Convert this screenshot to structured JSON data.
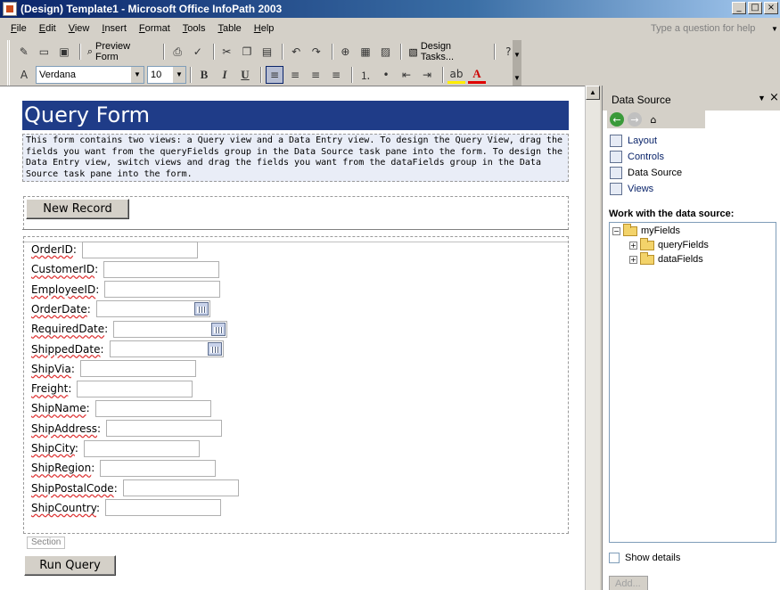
{
  "window": {
    "title": "(Design) Template1 - Microsoft Office InfoPath 2003",
    "controls": [
      "_",
      "□",
      "×"
    ]
  },
  "menubar": {
    "items": [
      "File",
      "Edit",
      "View",
      "Insert",
      "Format",
      "Tools",
      "Table",
      "Help"
    ],
    "help_placeholder": "Type a question for help"
  },
  "toolbar": {
    "preview_label": "Preview Form",
    "design_tasks_label": "Design Tasks...",
    "font_name": "Verdana",
    "font_size": "10",
    "bold": "B",
    "italic": "I",
    "underline": "U",
    "font_color_letter": "A"
  },
  "form": {
    "title": "Query Form",
    "description": "This form contains two views: a Query view and a Data Entry view. To design the Query View, drag the fields you want from the queryFields group in the Data Source task pane into the form. To design the Data Entry view, switch views and drag the fields you want from the dataFields group in the Data Source task pane into the form.",
    "new_record_label": "New Record",
    "run_query_label": "Run Query",
    "section_label": "Section",
    "fields": [
      {
        "name": "OrderID",
        "has_calendar": false
      },
      {
        "name": "CustomerID",
        "has_calendar": false
      },
      {
        "name": "EmployeeID",
        "has_calendar": false
      },
      {
        "name": "OrderDate",
        "has_calendar": true
      },
      {
        "name": "RequiredDate",
        "has_calendar": true
      },
      {
        "name": "ShippedDate",
        "has_calendar": true
      },
      {
        "name": "ShipVia",
        "has_calendar": false
      },
      {
        "name": "Freight",
        "has_calendar": false
      },
      {
        "name": "ShipName",
        "has_calendar": false
      },
      {
        "name": "ShipAddress",
        "has_calendar": false
      },
      {
        "name": "ShipCity",
        "has_calendar": false
      },
      {
        "name": "ShipRegion",
        "has_calendar": false
      },
      {
        "name": "ShipPostalCode",
        "has_calendar": false
      },
      {
        "name": "ShipCountry",
        "has_calendar": false
      }
    ]
  },
  "taskpane": {
    "title": "Data Source",
    "links": [
      "Layout",
      "Controls",
      "Data Source",
      "Views"
    ],
    "subheading": "Work with the data source:",
    "tree": {
      "root": "myFields",
      "children": [
        "queryFields",
        "dataFields"
      ]
    },
    "show_details_label": "Show details",
    "add_label": "Add..."
  },
  "colors": {
    "header_band": "#1f3c88",
    "description_bg": "#e9edf7",
    "window_face": "#d4d0c8"
  }
}
